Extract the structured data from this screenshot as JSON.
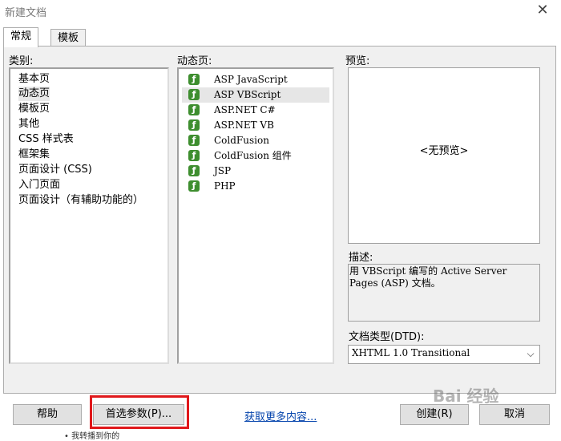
{
  "window": {
    "title": "新建文档"
  },
  "tabs": [
    {
      "label": "常规",
      "active": true
    },
    {
      "label": "模板",
      "active": false
    }
  ],
  "category": {
    "label": "类别:",
    "items": [
      "基本页",
      "动态页",
      "模板页",
      "其他",
      "CSS 样式表",
      "框架集",
      "页面设计 (CSS)",
      "入门页面",
      "页面设计（有辅助功能的）"
    ],
    "selected": "动态页"
  },
  "dynamic": {
    "label": "动态页:",
    "items": [
      "ASP JavaScript",
      "ASP VBScript",
      "ASP.NET C#",
      "ASP.NET VB",
      "ColdFusion",
      "ColdFusion 组件",
      "JSP",
      "PHP"
    ],
    "selected": "ASP VBScript",
    "icon": "dreamweaver-page-icon"
  },
  "preview": {
    "label": "预览:",
    "text": "<无预览>"
  },
  "description": {
    "label": "描述:",
    "text": "用 VBScript 编写的 Active Server Pages (ASP) 文档。"
  },
  "doctype": {
    "label": "文档类型(DTD):",
    "value": "XHTML 1.0 Transitional"
  },
  "buttons": {
    "help": "帮助",
    "prefs": "首选参数(P)...",
    "more_link": "获取更多内容...",
    "create": "创建(R)",
    "cancel": "取消"
  },
  "watermark": {
    "text": "Bai 经验"
  },
  "bottom_fragment": "• 我转播到你的"
}
